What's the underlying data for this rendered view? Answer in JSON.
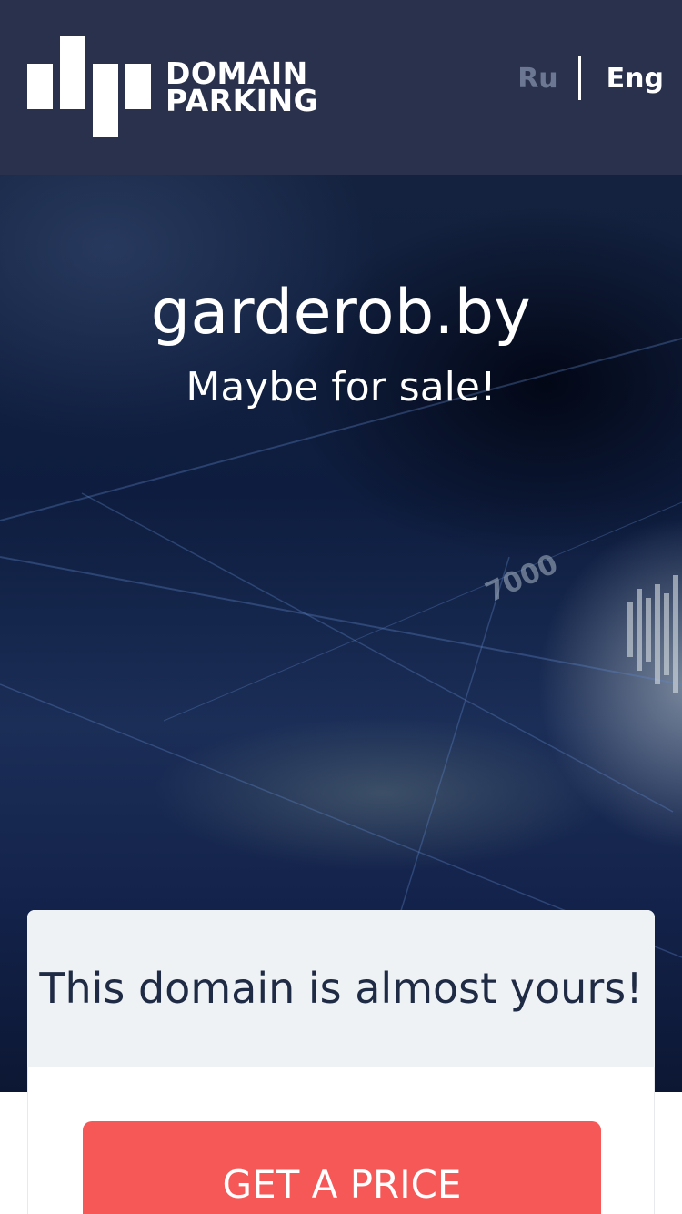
{
  "header": {
    "logo": {
      "line1": "DOMAIN",
      "line2": "PARKING"
    },
    "languages": {
      "ru": "Ru",
      "eng": "Eng",
      "active": "Eng"
    }
  },
  "hero": {
    "domain": "garderob.by",
    "subtitle": "Maybe for sale!",
    "background_number": "7000"
  },
  "card": {
    "headline": "This domain is almost yours!",
    "button_label": "GET A PRICE"
  },
  "colors": {
    "header_bg": "#29314c",
    "lang_inactive": "#6c7893",
    "card_head_bg": "#eef2f5",
    "card_text": "#1f2b44",
    "button_bg": "#f65857"
  }
}
